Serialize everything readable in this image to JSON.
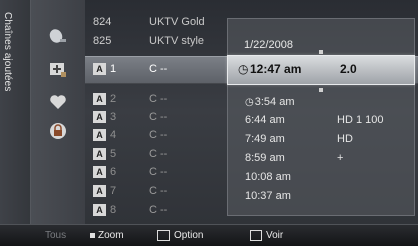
{
  "side_tab": {
    "label": "Chaînes ajoutées"
  },
  "icons": [
    "satellite-dish-icon",
    "add-channel-icon",
    "favorite-heart-icon",
    "lock-icon"
  ],
  "channels": [
    {
      "number": "824",
      "name": "UKTV Gold",
      "badge": ""
    },
    {
      "number": "825",
      "name": "UKTV style",
      "badge": ""
    },
    {
      "number": "1",
      "name": "C --",
      "badge": "A",
      "selected": true
    },
    {
      "number": "2",
      "name": "C --",
      "badge": "A"
    },
    {
      "number": "3",
      "name": "C --",
      "badge": "A"
    },
    {
      "number": "4",
      "name": "C --",
      "badge": "A"
    },
    {
      "number": "5",
      "name": "C --",
      "badge": "A"
    },
    {
      "number": "6",
      "name": "C --",
      "badge": "A"
    },
    {
      "number": "7",
      "name": "C --",
      "badge": "A"
    },
    {
      "number": "8",
      "name": "C --",
      "badge": "A"
    }
  ],
  "schedule": {
    "date": "1/22/2008",
    "selected": {
      "time": "12:47 am",
      "value": "2.0"
    },
    "items": [
      {
        "time": "3:54 am",
        "value": "",
        "clock": true
      },
      {
        "time": "6:44 am",
        "value": "HD 1 100"
      },
      {
        "time": "7:49 am",
        "value": "HD"
      },
      {
        "time": "8:59 am",
        "value": "+"
      },
      {
        "time": "10:08 am",
        "value": ""
      },
      {
        "time": "10:37 am",
        "value": ""
      }
    ]
  },
  "bottom_bar": {
    "all": "Tous",
    "zoom": "Zoom",
    "option": "Option",
    "view": "Voir"
  }
}
